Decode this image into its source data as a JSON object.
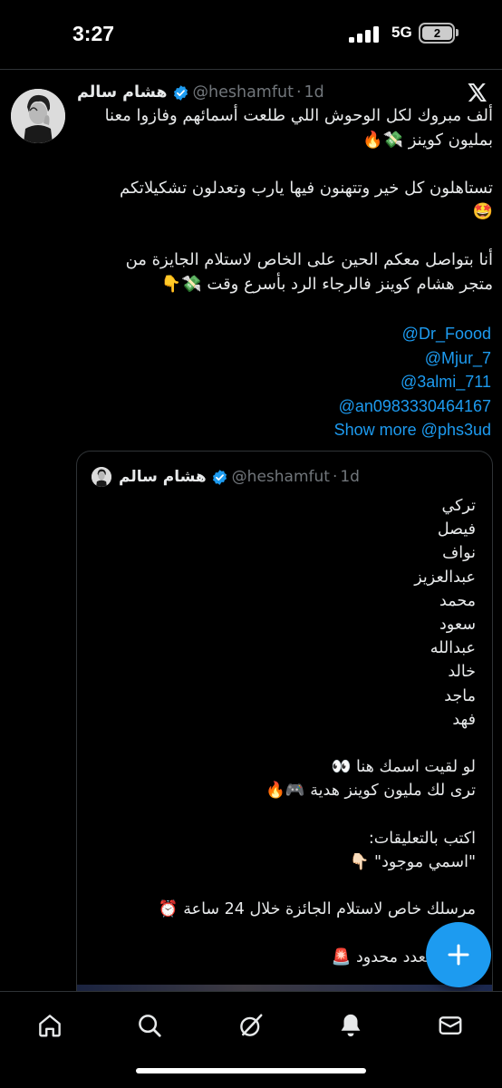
{
  "status_bar": {
    "time": "3:27",
    "network": "5G",
    "battery": "2"
  },
  "tweet": {
    "author_name": "هشام سالم",
    "handle": "@heshamfut",
    "separator": "·",
    "time_ago": "1d",
    "body_lines": [
      "ألف مبروك لكل الوحوش اللي طلعت أسمائهم وفازوا معنا",
      "بمليون كوينز 💸🔥",
      "",
      "تستاهلون كل خير وتتهنون فيها يارب وتعدلون تشكيلاتكم",
      "🤩",
      "",
      "أنا بتواصل معكم الحين على الخاص لاستلام الجايزة من",
      "متجر هشام كوينز فالرجاء الرد بأسرع وقت 💸👇"
    ],
    "mentions": [
      "@Dr_Foood",
      "@Mjur_7",
      "@3almi_711",
      "@an0983330464167"
    ],
    "show_more": "Show more",
    "last_mention": "@phs3ud"
  },
  "quoted_tweet": {
    "author_name": "هشام سالم",
    "handle": "@heshamfut",
    "separator": "·",
    "time_ago": "1d",
    "body_lines": [
      "تركي",
      "فيصل",
      "نواف",
      "عبدالعزيز",
      "محمد",
      "سعود",
      "عبدالله",
      "خالد",
      "ماجد",
      "فهد",
      "",
      "لو لقيت اسمك هنا 👀",
      "ترى لك مليون كوينز هدية 🎮🔥",
      "",
      "اكتب بالتعليقات:",
      "\"اسمي موجود\" 👇🏻",
      "",
      "مرسلك خاص لاستلام الجائزة خلال 24 ساعة ⏰",
      "",
      "لعدد والعدد محدود 🚨"
    ]
  },
  "fab": {
    "icon": "plus-icon"
  },
  "bottom_nav": {
    "items": [
      {
        "icon": "home-icon"
      },
      {
        "icon": "search-icon"
      },
      {
        "icon": "grok-icon"
      },
      {
        "icon": "notifications-icon"
      },
      {
        "icon": "messages-icon"
      }
    ]
  },
  "colors": {
    "background": "#000000",
    "text": "#e7e9ea",
    "muted": "#71767b",
    "accent": "#1d9bf0",
    "divider": "#2f3336"
  }
}
